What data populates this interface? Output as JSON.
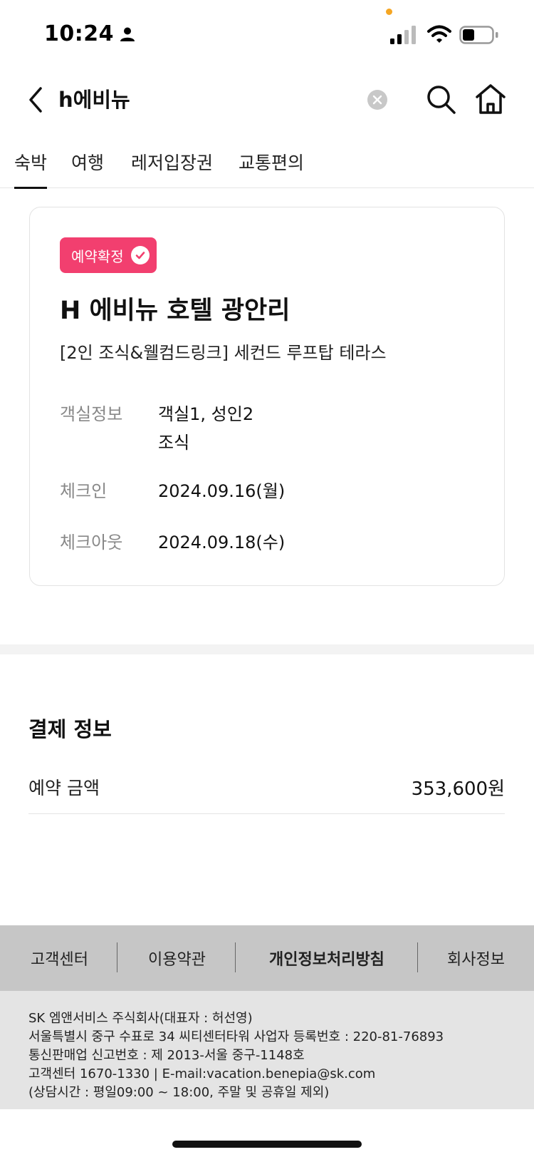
{
  "status_bar": {
    "time": "10:24",
    "colors": {
      "dot": "#f5a623"
    }
  },
  "header": {
    "search_value": "h에비뉴"
  },
  "tabs": [
    {
      "label": "숙박",
      "active": true
    },
    {
      "label": "여행",
      "active": false
    },
    {
      "label": "레저입장권",
      "active": false
    },
    {
      "label": "교통편의",
      "active": false
    }
  ],
  "booking": {
    "status": "예약확정",
    "hotel_name": "H 에비뉴 호텔 광안리",
    "room_name": "[2인 조식&웰컴드링크] 세컨드 루프탑 테라스",
    "rows": [
      {
        "label": "객실정보",
        "value": "객실1, 성인2",
        "value2": "조식"
      },
      {
        "label": "체크인",
        "value": "2024.09.16(월)"
      },
      {
        "label": "체크아웃",
        "value": "2024.09.18(수)"
      }
    ],
    "colors": {
      "badge": "#f23f6f"
    }
  },
  "payment": {
    "title": "결제 정보",
    "label": "예약 금액",
    "amount": "353,600원"
  },
  "footer": {
    "links": [
      "고객센터",
      "이용약관",
      "개인정보처리방침",
      "회사정보"
    ],
    "info": [
      "SK 엠앤서비스 주식회사(대표자 : 허선영)",
      "서울특별시 중구 수표로 34 씨티센터타워 사업자 등록번호 : 220-81-76893",
      "통신판매업 신고번호 : 제 2013-서울 중구-1148호",
      "고객센터 1670-1330 | E-mail:vacation.benepia@sk.com",
      "(상담시간 : 평일09:00 ~ 18:00, 주말 및 공휴일 제외)"
    ]
  },
  "icons": {
    "back": "chevron-left-icon",
    "clear": "close-circle-icon",
    "search": "search-icon",
    "home": "home-icon",
    "check": "check-icon"
  }
}
